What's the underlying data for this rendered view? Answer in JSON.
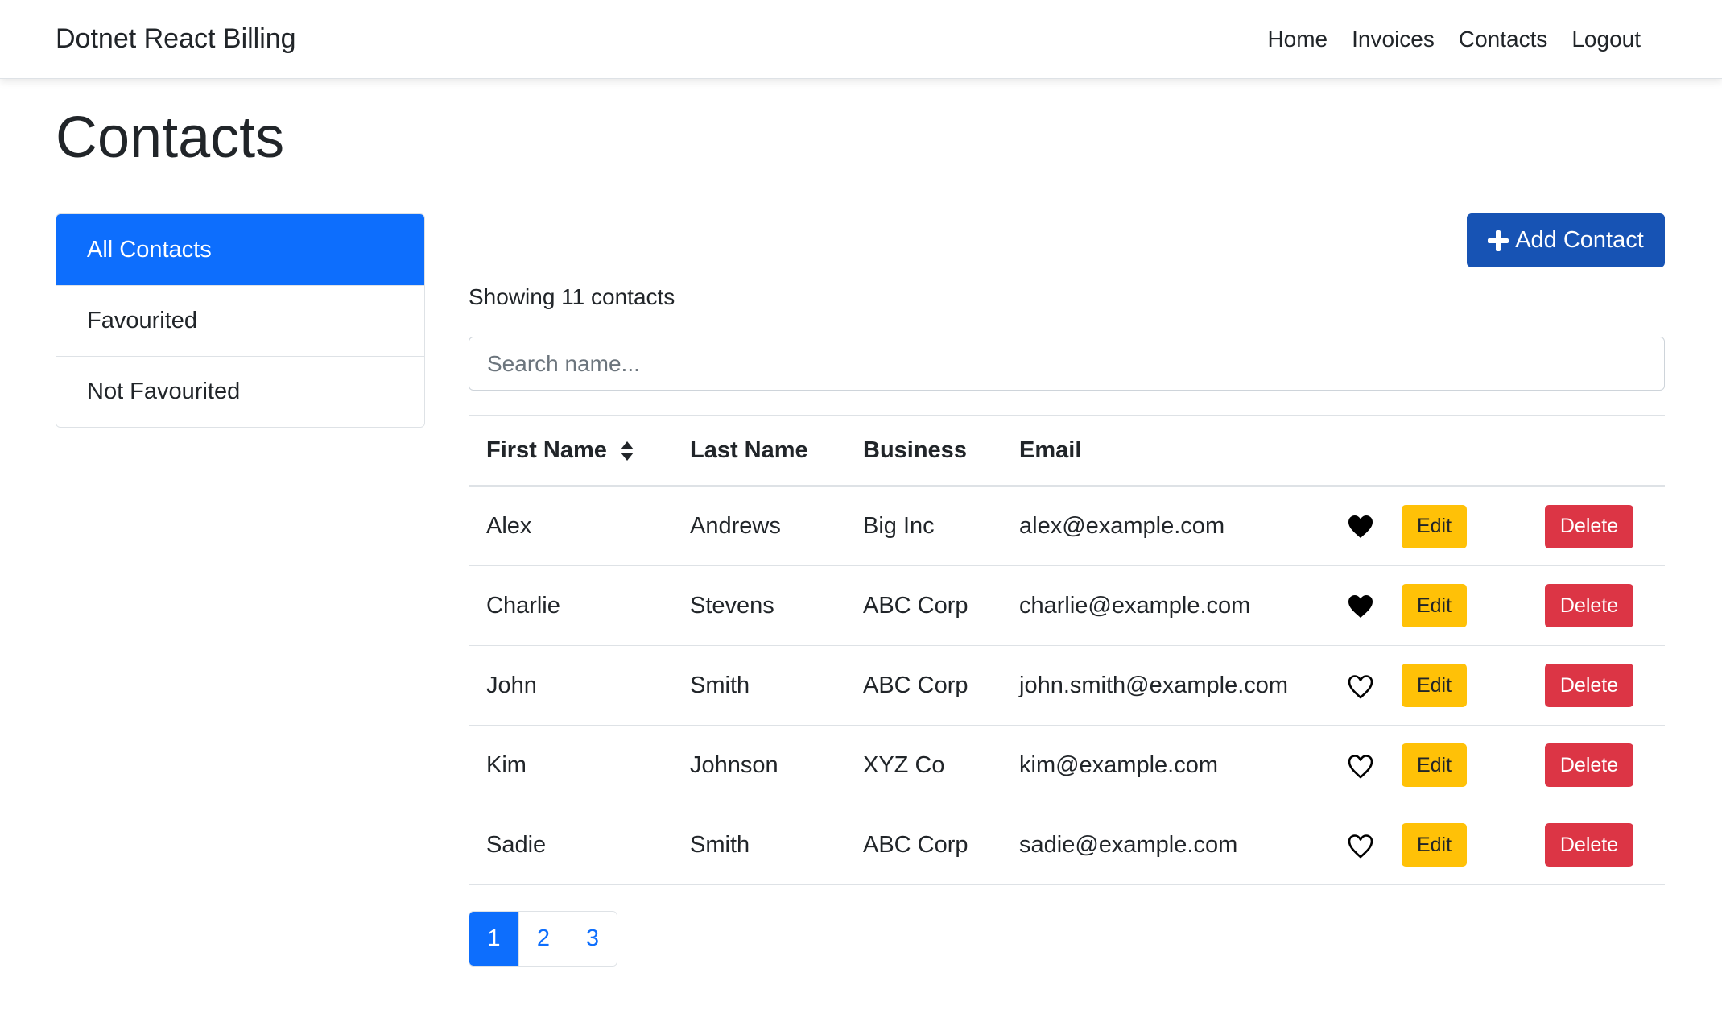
{
  "navbar": {
    "brand": "Dotnet React Billing",
    "links": [
      "Home",
      "Invoices",
      "Contacts",
      "Logout"
    ]
  },
  "page": {
    "title": "Contacts"
  },
  "sidebar": {
    "items": [
      {
        "label": "All Contacts",
        "active": true
      },
      {
        "label": "Favourited",
        "active": false
      },
      {
        "label": "Not Favourited",
        "active": false
      }
    ]
  },
  "toolbar": {
    "add_label": "Add Contact"
  },
  "summary": {
    "showing": "Showing 11 contacts"
  },
  "search": {
    "placeholder": "Search name..."
  },
  "table": {
    "headers": [
      "First Name",
      "Last Name",
      "Business",
      "Email"
    ],
    "edit_label": "Edit",
    "delete_label": "Delete",
    "rows": [
      {
        "first": "Alex",
        "last": "Andrews",
        "business": "Big Inc",
        "email": "alex@example.com",
        "favourite": true
      },
      {
        "first": "Charlie",
        "last": "Stevens",
        "business": "ABC Corp",
        "email": "charlie@example.com",
        "favourite": true
      },
      {
        "first": "John",
        "last": "Smith",
        "business": "ABC Corp",
        "email": "john.smith@example.com",
        "favourite": false
      },
      {
        "first": "Kim",
        "last": "Johnson",
        "business": "XYZ Co",
        "email": "kim@example.com",
        "favourite": false
      },
      {
        "first": "Sadie",
        "last": "Smith",
        "business": "ABC Corp",
        "email": "sadie@example.com",
        "favourite": false
      }
    ]
  },
  "pagination": {
    "pages": [
      "1",
      "2",
      "3"
    ],
    "current": "1"
  },
  "colors": {
    "primary": "#0d6efd",
    "add_button": "#1753b4",
    "edit": "#ffc107",
    "delete": "#dc3545"
  }
}
